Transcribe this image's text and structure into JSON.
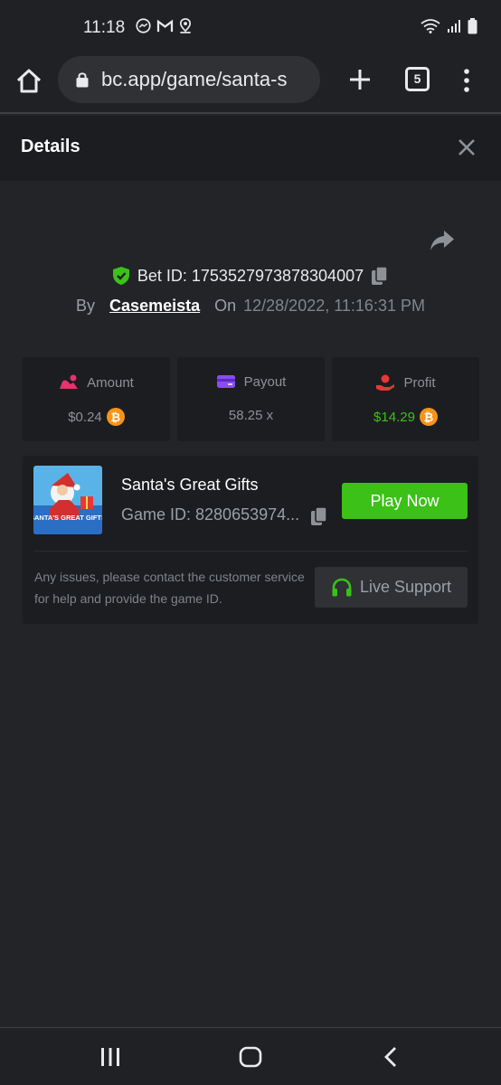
{
  "status_bar": {
    "time": "11:18",
    "icons": [
      "messenger-icon",
      "gmail-icon",
      "location-icon",
      "wifi-icon",
      "signal-icon",
      "battery-icon"
    ]
  },
  "browser": {
    "url": "bc.app/game/santa-s",
    "tab_count": "5"
  },
  "modal": {
    "title": "Details"
  },
  "bet": {
    "id_text": "Bet ID: 1753527973878304007",
    "by_label": "By",
    "username": "Casemeista",
    "on_label": "On",
    "date": "12/28/2022, 11:16:31 PM"
  },
  "stats": {
    "amount": {
      "label": "Amount",
      "value": "$0.24"
    },
    "payout": {
      "label": "Payout",
      "value": "58.25 x"
    },
    "profit": {
      "label": "Profit",
      "value": "$14.29"
    }
  },
  "currency_symbol": "₿",
  "game": {
    "name": "Santa's Great Gifts",
    "id_text": "Game ID: 8280653974...",
    "thumb_title": "SANTA'S GREAT GIFTS",
    "play_label": "Play Now",
    "issue_text": "Any issues, please contact the customer service for help and provide the game ID.",
    "support_label": "Live Support"
  },
  "colors": {
    "accent_green": "#3bc117",
    "background": "#232427",
    "panel": "#1c1d20",
    "bitcoin": "#f7931a"
  }
}
